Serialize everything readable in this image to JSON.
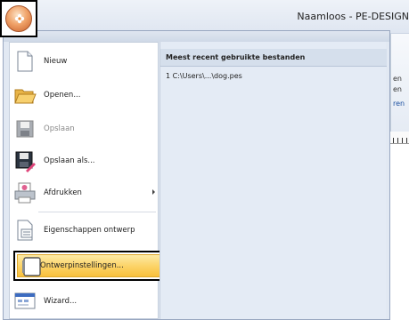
{
  "window": {
    "title": "Naamloos - PE-DESIGN"
  },
  "ribbon": {
    "fragments": [
      "en",
      "en",
      "ren"
    ]
  },
  "menu": {
    "items": [
      {
        "id": "nieuw",
        "label": "Nieuw",
        "icon": "new-document-icon"
      },
      {
        "id": "openen",
        "label": "Openen...",
        "icon": "open-folder-icon"
      },
      {
        "id": "opslaan",
        "label": "Opslaan",
        "icon": "save-icon",
        "disabled": true
      },
      {
        "id": "opslaan-als",
        "label": "Opslaan als...",
        "icon": "save-as-icon"
      },
      {
        "id": "afdrukken",
        "label": "Afdrukken",
        "icon": "print-icon",
        "submenu": true
      },
      {
        "id": "eigenschappen",
        "label": "Eigenschappen ontwerp",
        "icon": "design-properties-icon"
      },
      {
        "id": "ontwerpinstellingen",
        "label": "Ontwerpinstellingen...",
        "icon": "design-settings-icon",
        "highlighted": true
      },
      {
        "id": "wizard",
        "label": "Wizard...",
        "icon": "wizard-icon"
      }
    ],
    "recent": {
      "header": "Meest recent gebruikte bestanden",
      "files": [
        "1 C:\\Users\\...\\dog.pes"
      ]
    }
  },
  "colors": {
    "highlight": "#f8c03c",
    "menu_bg": "#e2e9f3"
  }
}
